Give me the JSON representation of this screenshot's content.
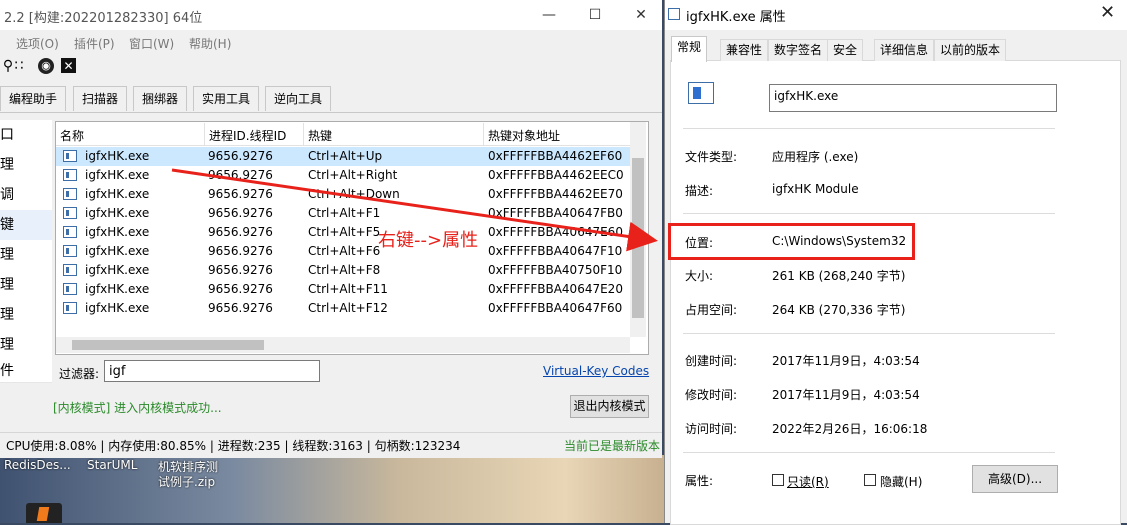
{
  "app": {
    "title": "2.2  [构建:202201282330]  64位",
    "menu": [
      "选项(O)",
      "插件(P)",
      "窗口(W)",
      "帮助(H)"
    ],
    "tabs": [
      "编程助手",
      "扫描器",
      "捆绑器",
      "实用工具",
      "逆向工具"
    ],
    "nav": [
      "口",
      "理",
      "调",
      "键",
      "理",
      "理",
      "理",
      "理",
      "理",
      "件"
    ],
    "columns": [
      "名称",
      "进程ID.线程ID",
      "热键",
      "热键对象地址"
    ],
    "rows": [
      [
        "igfxHK.exe",
        "9656.9276",
        "Ctrl+Alt+Up",
        "0xFFFFFBBA4462EF60"
      ],
      [
        "igfxHK.exe",
        "9656.9276",
        "Ctrl+Alt+Right",
        "0xFFFFFBBA4462EEC0"
      ],
      [
        "igfxHK.exe",
        "9656.9276",
        "Ctrl+Alt+Down",
        "0xFFFFFBBA4462EE70"
      ],
      [
        "igfxHK.exe",
        "9656.9276",
        "Ctrl+Alt+F1",
        "0xFFFFFBBA40647FB0"
      ],
      [
        "igfxHK.exe",
        "9656.9276",
        "Ctrl+Alt+F5",
        "0xFFFFFBBA40647E60"
      ],
      [
        "igfxHK.exe",
        "9656.9276",
        "Ctrl+Alt+F6",
        "0xFFFFFBBA40647F10"
      ],
      [
        "igfxHK.exe",
        "9656.9276",
        "Ctrl+Alt+F8",
        "0xFFFFFBBA40750F10"
      ],
      [
        "igfxHK.exe",
        "9656.9276",
        "Ctrl+Alt+F11",
        "0xFFFFFBBA40647E20"
      ],
      [
        "igfxHK.exe",
        "9656.9276",
        "Ctrl+Alt+F12",
        "0xFFFFFBBA40647F60"
      ]
    ],
    "filter_label": "过滤器:",
    "filter_value": "igf",
    "vk_link": "Virtual-Key Codes",
    "status_message": "[内核模式] 进入内核模式成功...",
    "exit_kernel_button": "退出内核模式",
    "statusbar": "CPU使用:8.08% | 内存使用:80.85% | 进程数:235 | 线程数:3163 | 句柄数:123234",
    "update_status": "当前已是最新版本"
  },
  "desktop": {
    "icons": [
      "RedisDes...",
      "StarUML",
      "机软排序测",
      "试例子.zip"
    ]
  },
  "annotation": {
    "text": "右键-->属性",
    "color": "#e8221b"
  },
  "props": {
    "title": "igfxHK.exe 属性",
    "tabs": [
      "常规",
      "兼容性",
      "数字签名",
      "安全",
      "详细信息",
      "以前的版本"
    ],
    "filename": "igfxHK.exe",
    "file_type_label": "文件类型:",
    "file_type": "应用程序 (.exe)",
    "desc_label": "描述:",
    "desc": "igfxHK Module",
    "location_label": "位置:",
    "location": "C:\\Windows\\System32",
    "size_label": "大小:",
    "size": "261 KB (268,240 字节)",
    "disk_size_label": "占用空间:",
    "disk_size": "264 KB (270,336 字节)",
    "created_label": "创建时间:",
    "created": "2017年11月9日，4:03:54",
    "modified_label": "修改时间:",
    "modified": "2017年11月9日，4:03:54",
    "accessed_label": "访问时间:",
    "accessed": "2022年2月26日，16:06:18",
    "attr_label": "属性:",
    "readonly": "只读(R)",
    "hidden": "隐藏(H)",
    "advanced_button": "高级(D)..."
  }
}
